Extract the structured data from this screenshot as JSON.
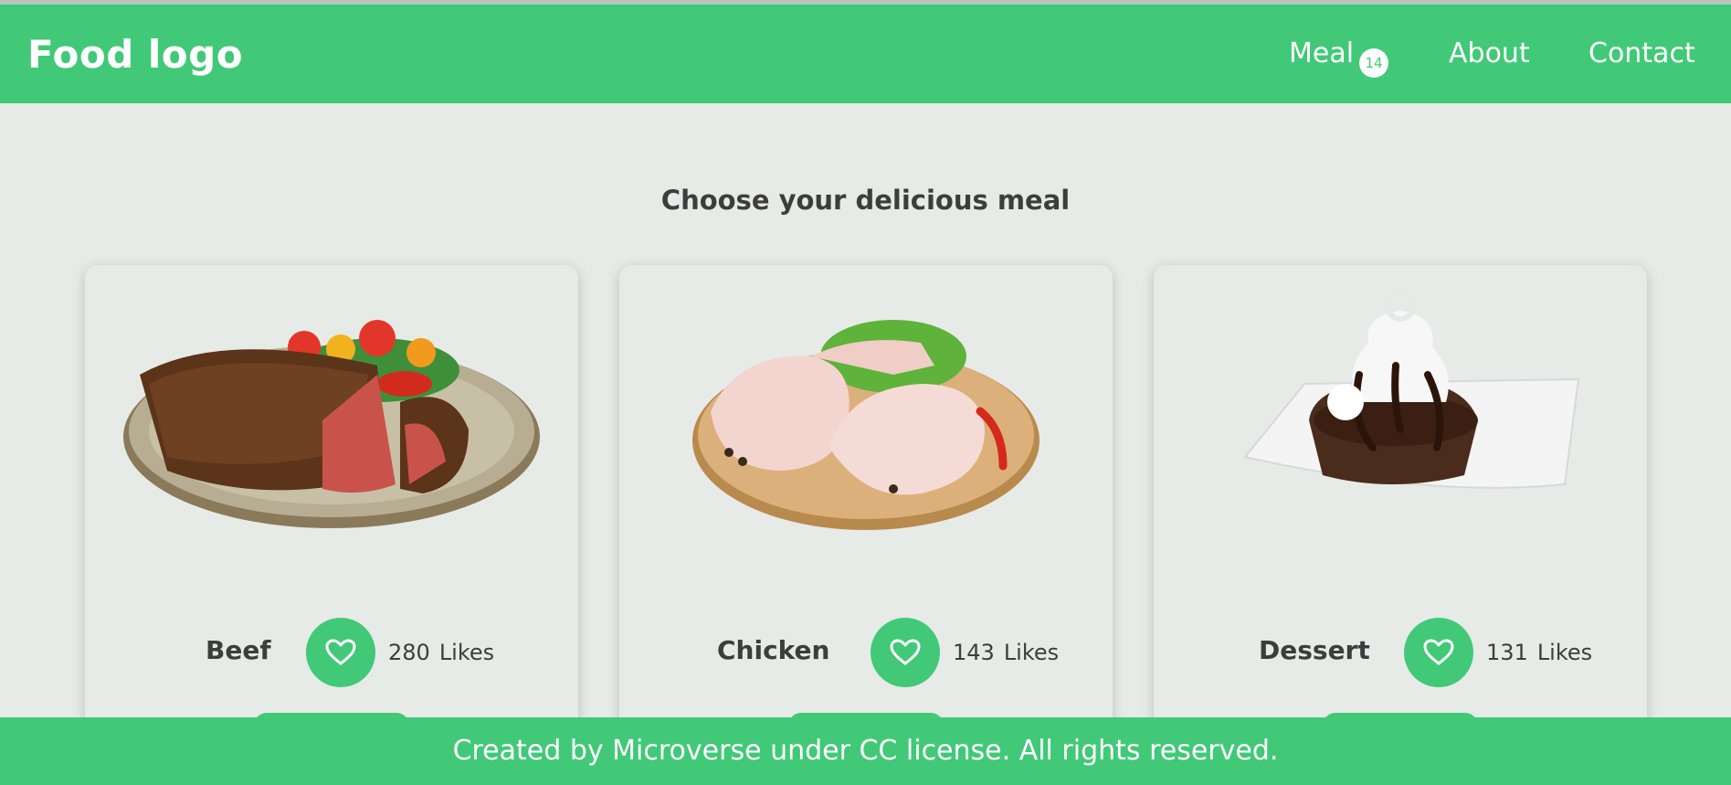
{
  "header": {
    "logo": "Food logo",
    "nav": {
      "meal_label": "Meal",
      "meal_count": "14",
      "about_label": "About",
      "contact_label": "Contact"
    }
  },
  "main": {
    "title": "Choose your delicious meal",
    "cards": [
      {
        "name": "Beef",
        "likes": "280",
        "likes_label": "Likes"
      },
      {
        "name": "Chicken",
        "likes": "143",
        "likes_label": "Likes"
      },
      {
        "name": "Dessert",
        "likes": "131",
        "likes_label": "Likes"
      }
    ]
  },
  "footer": {
    "text": "Created by Microverse under CC license. All rights reserved."
  },
  "colors": {
    "brand": "#41c978",
    "background": "#e6ebe7",
    "text": "#3d3d3d"
  }
}
